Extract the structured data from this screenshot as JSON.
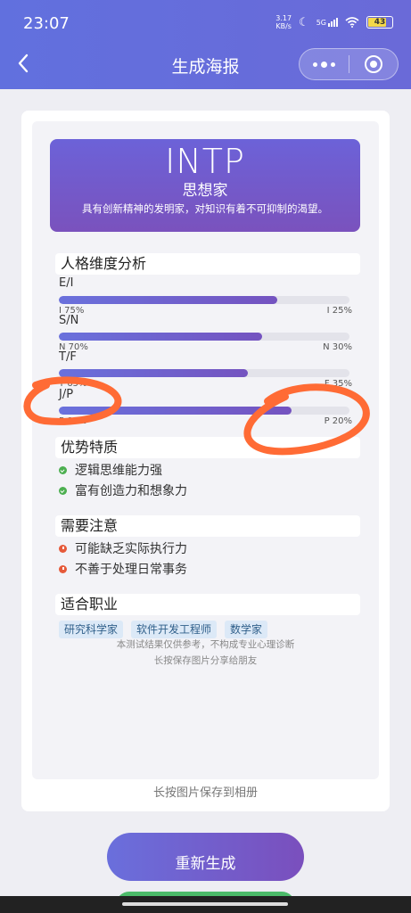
{
  "status_bar": {
    "time": "23:07",
    "net_speed": "3.17",
    "net_unit": "KB/s",
    "signal": "5G",
    "battery": "43"
  },
  "nav": {
    "title": "生成海报"
  },
  "poster": {
    "type": "INTP",
    "name": "思想家",
    "description": "具有创新精神的发明家，对知识有着不可抑制的渴望。",
    "dimensions_title": "人格维度分析",
    "dimensions": [
      {
        "label": "E/I",
        "left_text": "I 75%",
        "right_text": "I 25%",
        "value": 75
      },
      {
        "label": "S/N",
        "left_text": "N 70%",
        "right_text": "N 30%",
        "value": 70
      },
      {
        "label": "T/F",
        "left_text": "T 65%",
        "right_text": "F 35%",
        "value": 65
      },
      {
        "label": "J/P",
        "left_text": "P 80%",
        "right_text": "P 20%",
        "value": 80
      }
    ],
    "strengths_title": "优势特质",
    "strengths": [
      "逻辑思维能力强",
      "富有创造力和想象力"
    ],
    "cautions_title": "需要注意",
    "cautions": [
      "可能缺乏实际执行力",
      "不善于处理日常事务"
    ],
    "careers_title": "适合职业",
    "careers": [
      "研究科学家",
      "软件开发工程师",
      "数学家"
    ],
    "disclaimer_1": "本测试结果仅供参考，不构成专业心理诊断",
    "disclaimer_2": "长按保存图片分享给朋友"
  },
  "save_hint": "长按图片保存到相册",
  "regenerate_label": "重新生成",
  "colors": {
    "header": "#6170de",
    "accent": "#7453c0",
    "annotation": "#ff6b35"
  }
}
